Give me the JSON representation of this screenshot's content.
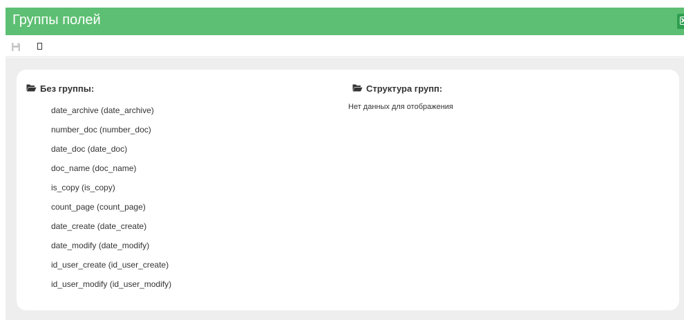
{
  "header": {
    "title": "Группы полей",
    "close_icon": "close-icon",
    "accent_color": "#5dbf73"
  },
  "toolbar": {
    "save_icon": "save-icon",
    "extra_glyph": "▯"
  },
  "left_panel": {
    "title": "Без группы:",
    "icon": "folder-open-icon",
    "fields": [
      "date_archive (date_archive)",
      "number_doc (number_doc)",
      "date_doc (date_doc)",
      "doc_name (doc_name)",
      "is_copy (is_copy)",
      "count_page (count_page)",
      "date_create (date_create)",
      "date_modify (date_modify)",
      "id_user_create (id_user_create)",
      "id_user_modify (id_user_modify)"
    ]
  },
  "right_panel": {
    "title": "Структура групп:",
    "icon": "folder-open-icon",
    "empty_text": "Нет данных для отображения"
  }
}
